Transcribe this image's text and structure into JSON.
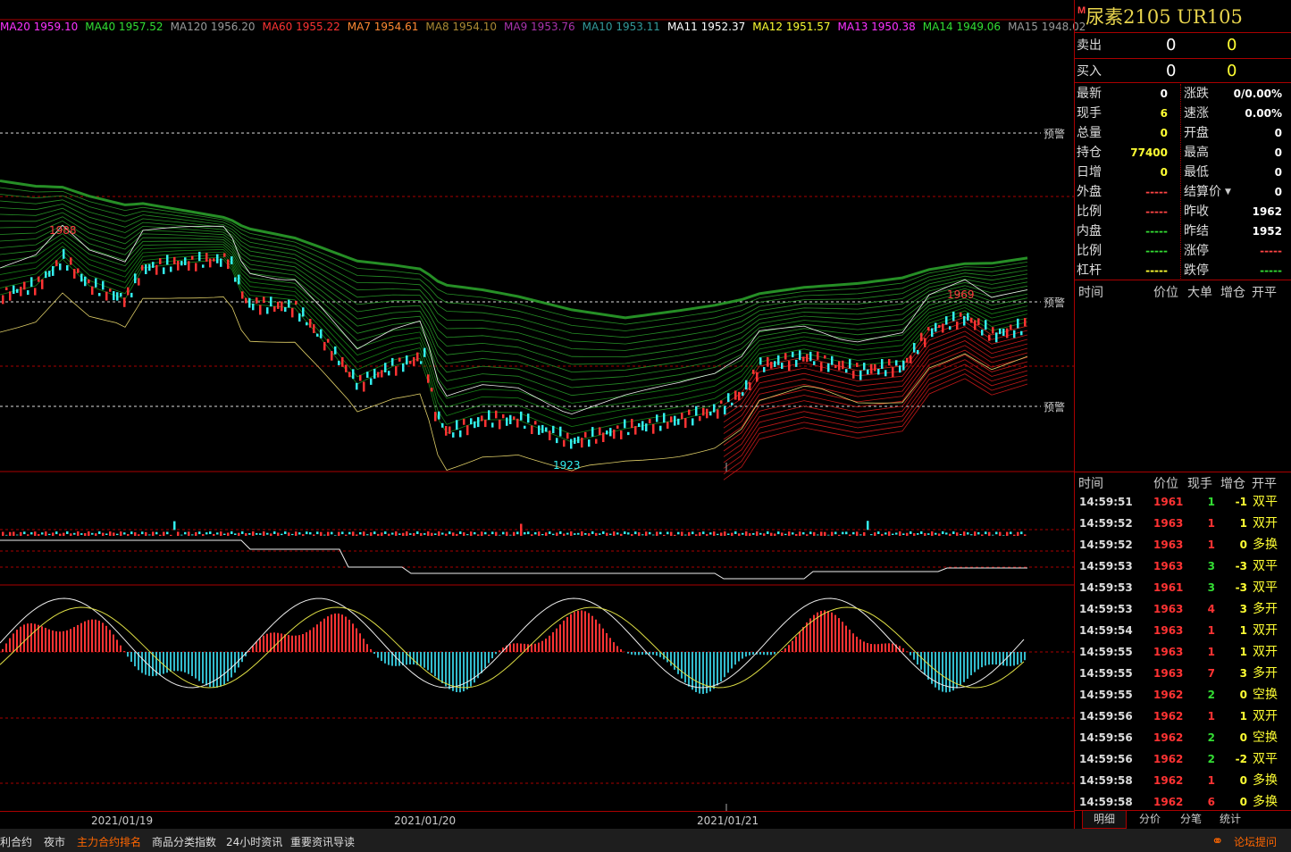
{
  "ma_legend": [
    {
      "label": "MA20 1959.10",
      "color": "#ff33ff"
    },
    {
      "label": "MA40 1957.52",
      "color": "#33dd33"
    },
    {
      "label": "MA120 1956.20",
      "color": "#999999"
    },
    {
      "label": "MA60 1955.22",
      "color": "#ff3333"
    },
    {
      "label": "MA7 1954.61",
      "color": "#ff8833"
    },
    {
      "label": "MA8 1954.10",
      "color": "#aa8833"
    },
    {
      "label": "MA9 1953.76",
      "color": "#aa33aa"
    },
    {
      "label": "MA10 1953.11",
      "color": "#339999"
    },
    {
      "label": "MA11 1952.37",
      "color": "#ffffff"
    },
    {
      "label": "MA12 1951.57",
      "color": "#ffff33"
    },
    {
      "label": "MA13 1950.38",
      "color": "#ff33ff"
    },
    {
      "label": "MA14 1949.06",
      "color": "#33dd33"
    },
    {
      "label": "MA15 1948.02",
      "color": "#999999"
    }
  ],
  "chart": {
    "high_label": "1988",
    "high_label2": "1969",
    "low_label": "1923",
    "alert_label": "预警",
    "dates": [
      "2021/01/19",
      "2021/01/20",
      "2021/01/21"
    ]
  },
  "quote": {
    "title_mark": "M",
    "title": "尿素2105  UR105",
    "sell_label": "卖出",
    "sell_price": "0",
    "sell_vol": "0",
    "buy_label": "买入",
    "buy_price": "0",
    "buy_vol": "0",
    "rows": [
      {
        "l1": "最新",
        "v1": "0",
        "c1": "#ffffff",
        "l2": "涨跌",
        "v2": "0/0.00%",
        "c2": "#ffffff"
      },
      {
        "l1": "现手",
        "v1": "6",
        "c1": "#ffff33",
        "l2": "速涨",
        "v2": "0.00%",
        "c2": "#ffffff"
      },
      {
        "l1": "总量",
        "v1": "0",
        "c1": "#ffff33",
        "l2": "开盘",
        "v2": "0",
        "c2": "#ffffff"
      },
      {
        "l1": "持仓",
        "v1": "77400",
        "c1": "#ffff33",
        "l2": "最高",
        "v2": "0",
        "c2": "#ffffff"
      },
      {
        "l1": "日增",
        "v1": "0",
        "c1": "#ffff33",
        "l2": "最低",
        "v2": "0",
        "c2": "#ffffff"
      },
      {
        "l1": "外盘",
        "v1": "-----",
        "c1": "#ff4444",
        "l2": "结算价",
        "v2": "0",
        "c2": "#ffffff"
      },
      {
        "l1": "比例",
        "v1": "-----",
        "c1": "#ff4444",
        "l2": "昨收",
        "v2": "1962",
        "c2": "#ffffff"
      },
      {
        "l1": "内盘",
        "v1": "-----",
        "c1": "#33dd33",
        "l2": "昨结",
        "v2": "1952",
        "c2": "#ffffff"
      },
      {
        "l1": "比例",
        "v1": "-----",
        "c1": "#33dd33",
        "l2": "涨停",
        "v2": "-----",
        "c2": "#ff4444"
      },
      {
        "l1": "杠杆",
        "v1": "-----",
        "c1": "#ffff33",
        "l2": "跌停",
        "v2": "-----",
        "c2": "#33dd33"
      }
    ],
    "big_header": [
      "时间",
      "价位",
      "大单",
      "增仓",
      "开平"
    ],
    "tick_header": [
      "时间",
      "价位",
      "现手",
      "增仓",
      "开平"
    ],
    "ticks": [
      {
        "time": "14:59:51",
        "price": "1961",
        "vol": "1",
        "oi": "-1",
        "type": "双平"
      },
      {
        "time": "14:59:52",
        "price": "1963",
        "vol": "1",
        "oi": "1",
        "type": "双开"
      },
      {
        "time": "14:59:52",
        "price": "1963",
        "vol": "1",
        "oi": "0",
        "type": "多换"
      },
      {
        "time": "14:59:53",
        "price": "1963",
        "vol": "3",
        "oi": "-3",
        "type": "双平"
      },
      {
        "time": "14:59:53",
        "price": "1961",
        "vol": "3",
        "oi": "-3",
        "type": "双平"
      },
      {
        "time": "14:59:53",
        "price": "1963",
        "vol": "4",
        "oi": "3",
        "type": "多开"
      },
      {
        "time": "14:59:54",
        "price": "1963",
        "vol": "1",
        "oi": "1",
        "type": "双开"
      },
      {
        "time": "14:59:55",
        "price": "1963",
        "vol": "1",
        "oi": "1",
        "type": "双开"
      },
      {
        "time": "14:59:55",
        "price": "1963",
        "vol": "7",
        "oi": "3",
        "type": "多开"
      },
      {
        "time": "14:59:55",
        "price": "1962",
        "vol": "2",
        "oi": "0",
        "type": "空换"
      },
      {
        "time": "14:59:56",
        "price": "1962",
        "vol": "1",
        "oi": "1",
        "type": "双开"
      },
      {
        "time": "14:59:56",
        "price": "1962",
        "vol": "2",
        "oi": "0",
        "type": "空换"
      },
      {
        "time": "14:59:56",
        "price": "1962",
        "vol": "2",
        "oi": "-2",
        "type": "双平"
      },
      {
        "time": "14:59:58",
        "price": "1962",
        "vol": "1",
        "oi": "0",
        "type": "多换"
      },
      {
        "time": "14:59:58",
        "price": "1962",
        "vol": "6",
        "oi": "0",
        "type": "多换"
      }
    ],
    "tabs": [
      "明细",
      "分价",
      "分笔",
      "统计"
    ]
  },
  "bottom_bar": {
    "items": [
      "利合约",
      "夜市",
      "主力合约排名",
      "商品分类指数",
      "24小时资讯",
      "重要资讯导读"
    ],
    "active_index": 2,
    "forum": "论坛提问"
  },
  "colors": {
    "up": "#ff3333",
    "down": "#33eeee",
    "grid": "#aa0000",
    "accent": "#ff6600"
  }
}
